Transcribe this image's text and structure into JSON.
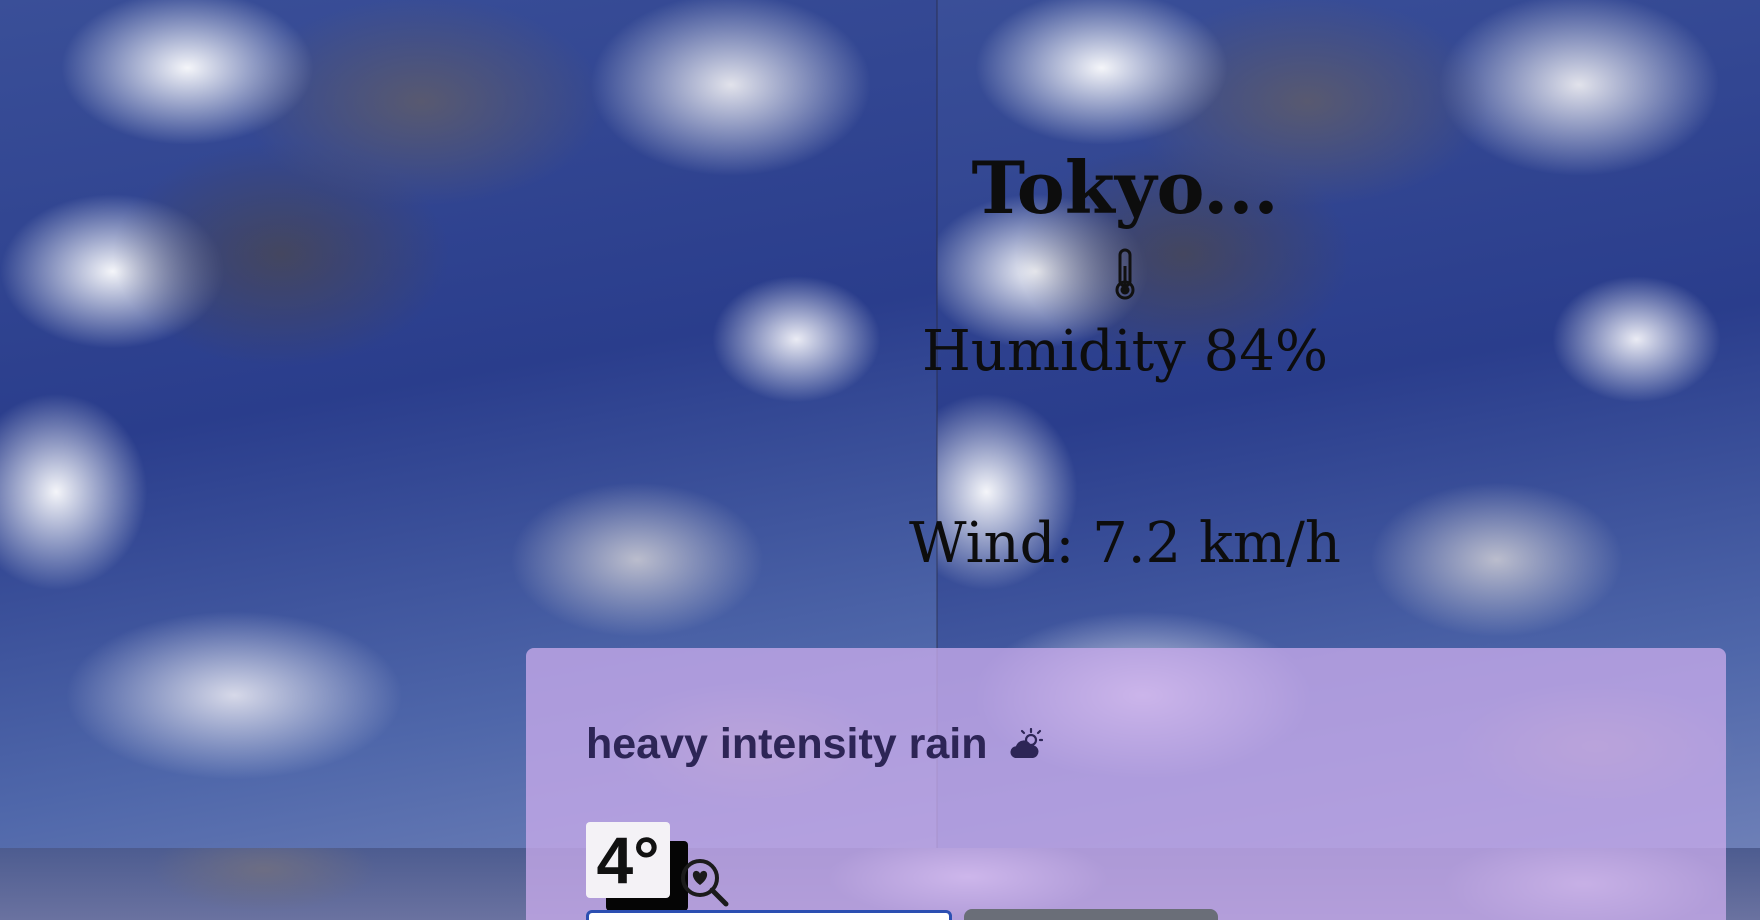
{
  "weather": {
    "city": "Tokyo...",
    "humidity": "Humidity 84%",
    "wind": "Wind: 7.2 km/h",
    "description": "heavy intensity rain",
    "temperature": "4°",
    "thermometer_icon": "thermometer-icon",
    "condition_icon": "cloud-sun-icon"
  },
  "search": {
    "icon": "search-heart-icon",
    "value": "",
    "button_label": ""
  },
  "colors": {
    "card": "#c8aaeb",
    "description_text": "#2d2556",
    "input_border": "#2c4fb2",
    "button": "#6a6e78"
  }
}
